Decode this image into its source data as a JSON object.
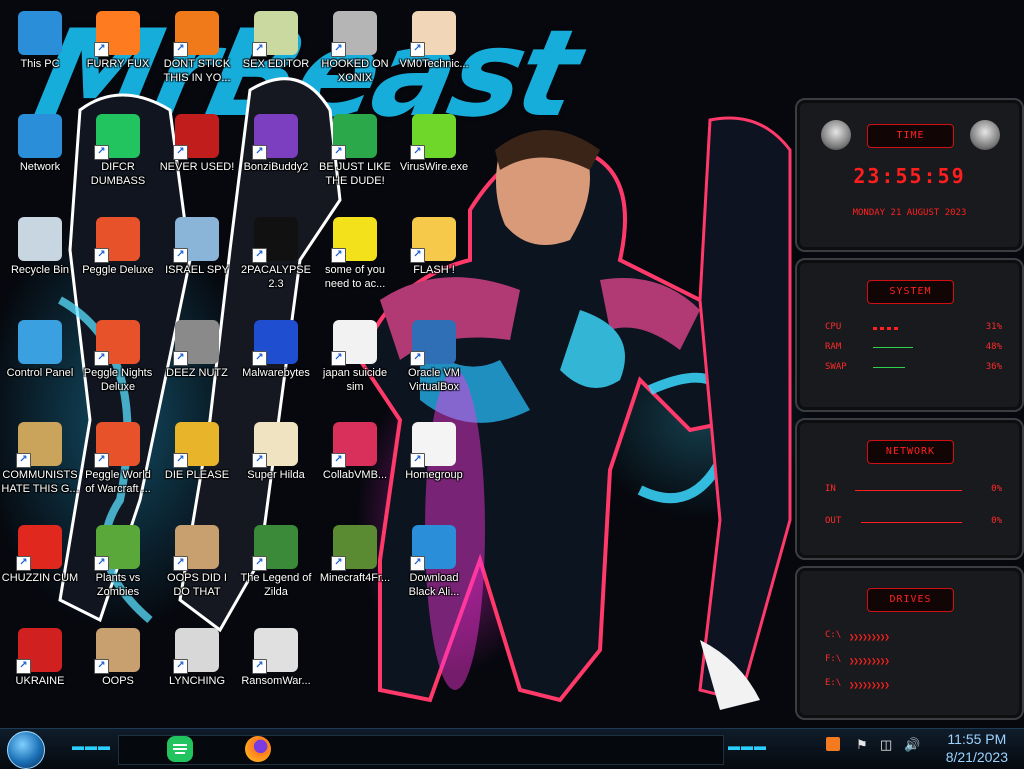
{
  "wallpaper": {
    "title_text": "MrBeast"
  },
  "desktop_icons": [
    {
      "label": "This PC",
      "icon": "monitor-icon",
      "color": "#2a8fd8"
    },
    {
      "label": "FURRY FUX",
      "icon": "firefox-icon",
      "color": "#ff7b1f"
    },
    {
      "label": "DONT STICK THIS IN YO...",
      "icon": "vlc-cone-icon",
      "color": "#f07a1a"
    },
    {
      "label": "SEX EDITOR",
      "icon": "hxd-icon",
      "color": "#c9d9a0"
    },
    {
      "label": "HOOKED ON XONIX",
      "icon": "xonix-game-icon",
      "color": "#b5b5b5"
    },
    {
      "label": "VM0Technic...",
      "icon": "doctor-icon",
      "color": "#f1d6b8"
    },
    {
      "label": "Network",
      "icon": "network-globe-icon",
      "color": "#2a8fd8"
    },
    {
      "label": "DIFCR DUMBASS",
      "icon": "discord-chat-icon",
      "color": "#21c45f"
    },
    {
      "label": "NEVER USED!",
      "icon": "devcpp-icon",
      "color": "#c21d1d"
    },
    {
      "label": "BonziBuddy2",
      "icon": "bonzi-icon",
      "color": "#7c3fbf"
    },
    {
      "label": "BE JUST LIKE THE DUDE!",
      "icon": "elf-icon",
      "color": "#2ba84a"
    },
    {
      "label": "VirusWire.exe",
      "icon": "lime-icon",
      "color": "#6fd62a"
    },
    {
      "label": "Recycle Bin",
      "icon": "recycle-bin-icon",
      "color": "#c8d6e2"
    },
    {
      "label": "Peggle Deluxe",
      "icon": "peggle-icon",
      "color": "#e8522a"
    },
    {
      "label": "ISRAEL SPY",
      "icon": "spy-search-icon",
      "color": "#8ab4d8"
    },
    {
      "label": "2PACALYPSE 2.3",
      "icon": "terminal-icon",
      "color": "#111111"
    },
    {
      "label": "some of you need to ac...",
      "icon": "beaver-icon",
      "color": "#f3e21b"
    },
    {
      "label": "FLASH !",
      "icon": "folder-icon",
      "color": "#f6c94a"
    },
    {
      "label": "Control Panel",
      "icon": "control-panel-icon",
      "color": "#3aa0e0"
    },
    {
      "label": "Peggle Nights Deluxe",
      "icon": "peggle-icon",
      "color": "#e8522a"
    },
    {
      "label": "DEEZ NUTZ",
      "icon": "windows-stack-icon",
      "color": "#8a8a8a"
    },
    {
      "label": "Malwarebytes",
      "icon": "malwarebytes-icon",
      "color": "#1f4fd0"
    },
    {
      "label": "japan suicide sim",
      "icon": "document-arrows-icon",
      "color": "#f2f2f2"
    },
    {
      "label": "Oracle VM VirtualBox",
      "icon": "virtualbox-icon",
      "color": "#2f6fb6"
    },
    {
      "label": "COMMUNISTS HATE THIS G...",
      "icon": "money-bag-icon",
      "color": "#c9a45a"
    },
    {
      "label": "Peggle World of Warcraft ...",
      "icon": "peggle-icon",
      "color": "#e8522a"
    },
    {
      "label": "DIE PLEASE",
      "icon": "dreamweaver-icon",
      "color": "#e8b52a"
    },
    {
      "label": "Super Hilda",
      "icon": "pixel-art-icon",
      "color": "#efe3c2"
    },
    {
      "label": "CollabVMB...",
      "icon": "monitor-pink-icon",
      "color": "#d8305a"
    },
    {
      "label": "Homegroup",
      "icon": "blank-file-icon",
      "color": "#f4f4f4"
    },
    {
      "label": "CHUZZIN CUM",
      "icon": "chuzzle-icon",
      "color": "#e0281e"
    },
    {
      "label": "Plants vs Zombies",
      "icon": "plants-icon",
      "color": "#5aa83a"
    },
    {
      "label": "OOPS DID I DO THAT",
      "icon": "portrait-icon",
      "color": "#c8a070"
    },
    {
      "label": "The Legend of Zilda",
      "icon": "zelda-icon",
      "color": "#3a8a3a"
    },
    {
      "label": "Minecraft4Fr...",
      "icon": "minecraft-block-icon",
      "color": "#5a8a32"
    },
    {
      "label": "Download Black Ali...",
      "icon": "network-globe-icon",
      "color": "#2a8fd8"
    },
    {
      "label": "UKRAINE",
      "icon": "radiation-icon",
      "color": "#d02020"
    },
    {
      "label": "OOPS",
      "icon": "portrait-icon",
      "color": "#c8a070"
    },
    {
      "label": "LYNCHING",
      "icon": "noose-icon",
      "color": "#d8d8d8"
    },
    {
      "label": "RansomWar...",
      "icon": "skull-icon",
      "color": "#e0e0e0"
    }
  ],
  "widgets": {
    "time": {
      "header": "TIME",
      "clock": "23:55:59",
      "date": "MONDAY 21 AUGUST 2023"
    },
    "system": {
      "header": "SYSTEM",
      "rows": [
        {
          "label": "CPU",
          "value": "31%",
          "fraction": 0.31
        },
        {
          "label": "RAM",
          "value": "48%",
          "fraction": 0.48
        },
        {
          "label": "SWAP",
          "value": "36%",
          "fraction": 0.36
        }
      ]
    },
    "network": {
      "header": "NETWORK",
      "rows": [
        {
          "label": "IN",
          "value": "0%"
        },
        {
          "label": "OUT",
          "value": "0%"
        }
      ]
    },
    "drives": {
      "header": "DRIVES",
      "rows": [
        {
          "label": "C:\\"
        },
        {
          "label": "F:\\"
        },
        {
          "label": "E:\\"
        }
      ]
    }
  },
  "taskbar": {
    "start_icon": "start-orb-icon",
    "pinned": [
      {
        "name": "discord-chat-icon",
        "color": "#21c45f"
      },
      {
        "name": "firefox-icon",
        "color": "#ff7b1f"
      }
    ],
    "tray_icons": [
      "sublime-icon",
      "flag-icon",
      "network-icon",
      "volume-icon"
    ],
    "time": "11:55 PM",
    "date": "8/21/2023"
  },
  "colors": {
    "accent_red": "#ff2020",
    "accent_cyan": "#18b6e6",
    "icon_text": "#ffffff"
  }
}
